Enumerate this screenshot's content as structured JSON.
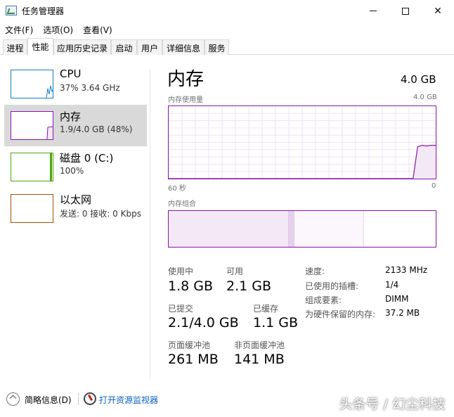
{
  "window": {
    "title": "任务管理器"
  },
  "menu": [
    "文件(F)",
    "选项(O)",
    "查看(V)"
  ],
  "tabs": [
    "进程",
    "性能",
    "应用历史记录",
    "启动",
    "用户",
    "详细信息",
    "服务"
  ],
  "active_tab": "性能",
  "sidebar": {
    "items": [
      {
        "name": "CPU",
        "sub": "37%  3.64 GHz",
        "color": "#117dbb",
        "selected": false
      },
      {
        "name": "内存",
        "sub": "1.9/4.0 GB (48%)",
        "color": "#8b12ae",
        "selected": true
      },
      {
        "name": "磁盘 0 (C:)",
        "sub": "100%",
        "color": "#4da60c",
        "selected": false
      },
      {
        "name": "以太网",
        "sub": "发送: 0  接收: 0 Kbps",
        "color": "#a74f01",
        "selected": false
      }
    ]
  },
  "memory": {
    "title": "内存",
    "total": "4.0 GB",
    "usage_chart": {
      "label": "内存使用量",
      "max_label": "4.0 GB",
      "left_label": "60 秒",
      "right_label": "0",
      "usage_history_percent": [
        0,
        0,
        0,
        0,
        0,
        0,
        0,
        0,
        0,
        0,
        0,
        0,
        0,
        0,
        0,
        0,
        0,
        0,
        0,
        0,
        0,
        0,
        0,
        0,
        0,
        0,
        0,
        0,
        0,
        0,
        0,
        0,
        0,
        0,
        0,
        0,
        0,
        0,
        0,
        0,
        0,
        0,
        0,
        0,
        0,
        0,
        0,
        0,
        0,
        0,
        0,
        0,
        0,
        0,
        0,
        44,
        46,
        45,
        46,
        46
      ]
    },
    "composition": {
      "label": "内存组合",
      "in_use_fraction": 0.45,
      "modified_fraction": 0.02,
      "standby_fraction": 0.26,
      "free_fraction": 0.27
    },
    "stats": {
      "in_use_label": "使用中",
      "in_use": "1.8 GB",
      "available_label": "可用",
      "available": "2.1 GB",
      "committed_label": "已提交",
      "committed": "2.1/4.0 GB",
      "cached_label": "已缓存",
      "cached": "1.1 GB",
      "paged_label": "页面缓冲池",
      "paged": "261 MB",
      "nonpaged_label": "非页面缓冲池",
      "nonpaged": "141 MB"
    },
    "details": [
      {
        "label": "速度:",
        "value": "2133 MHz"
      },
      {
        "label": "已使用的插槽:",
        "value": "1/4"
      },
      {
        "label": "组成要素:",
        "value": "DIMM"
      },
      {
        "label": "为硬件保留的内存:",
        "value": "37.2 MB"
      }
    ]
  },
  "footer": {
    "fewer_details": "简略信息(D)",
    "open_resmon": "打开资源监视器"
  },
  "watermark": "头条号 / 幻尘科技",
  "colors": {
    "memory_accent": "#8b12ae",
    "selection": "#d9d9d9",
    "link": "#0b62c4"
  }
}
